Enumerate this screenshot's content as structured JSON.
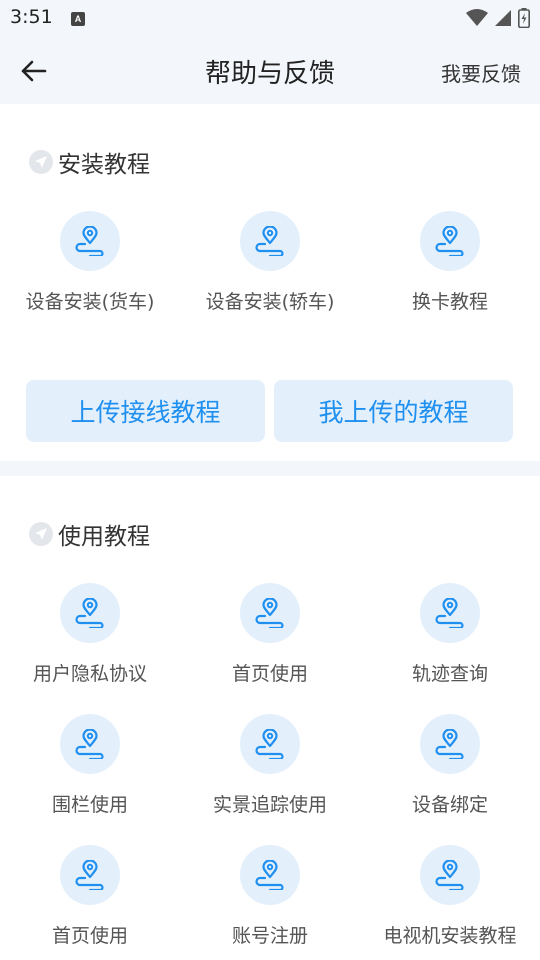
{
  "status_bar": {
    "time": "3:51",
    "notification_icon": "A"
  },
  "header": {
    "back_icon": "arrow-left-icon",
    "title": "帮助与反馈",
    "action_label": "我要反馈"
  },
  "install_section": {
    "title": "安装教程",
    "items": [
      {
        "label": "设备安装(货车)"
      },
      {
        "label": "设备安装(轿车)"
      },
      {
        "label": "换卡教程"
      }
    ],
    "buttons": {
      "upload_wiring": "上传接线教程",
      "my_uploads": "我上传的教程"
    }
  },
  "usage_section": {
    "title": "使用教程",
    "items": [
      {
        "label": "用户隐私协议"
      },
      {
        "label": "首页使用"
      },
      {
        "label": "轨迹查询"
      },
      {
        "label": "围栏使用"
      },
      {
        "label": "实景追踪使用"
      },
      {
        "label": "设备绑定"
      },
      {
        "label": "首页使用"
      },
      {
        "label": "账号注册"
      },
      {
        "label": "电视机安装教程"
      }
    ]
  },
  "colors": {
    "accent": "#1f8ff0",
    "icon_bg": "#e3f0fc",
    "page_bg": "#f3f6fa"
  }
}
